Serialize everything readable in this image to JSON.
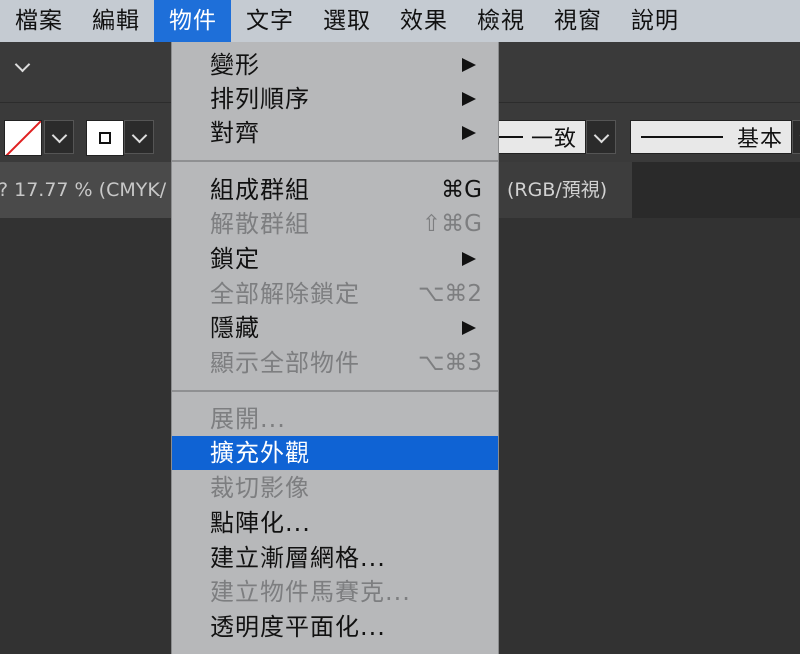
{
  "menubar": {
    "items": [
      "檔案",
      "編輯",
      "物件",
      "文字",
      "選取",
      "效果",
      "檢視",
      "視窗",
      "說明"
    ],
    "active": "物件"
  },
  "toolbar": {
    "stroke_profile": "一致",
    "brush": "基本"
  },
  "tabs": {
    "doc1": "17.77 % (CMYK/",
    "doc2": "(RGB/預視)"
  },
  "object_menu": {
    "items": [
      {
        "label": "變形",
        "shortcut": "",
        "submenu": true,
        "enabled": true
      },
      {
        "label": "排列順序",
        "shortcut": "",
        "submenu": true,
        "enabled": true
      },
      {
        "label": "對齊",
        "shortcut": "",
        "submenu": true,
        "enabled": true
      },
      {
        "label": "組成群組",
        "shortcut": "⌘G",
        "submenu": false,
        "enabled": true
      },
      {
        "label": "解散群組",
        "shortcut": "⇧⌘G",
        "submenu": false,
        "enabled": false
      },
      {
        "label": "鎖定",
        "shortcut": "",
        "submenu": true,
        "enabled": true
      },
      {
        "label": "全部解除鎖定",
        "shortcut": "⌥⌘2",
        "submenu": false,
        "enabled": false
      },
      {
        "label": "隱藏",
        "shortcut": "",
        "submenu": true,
        "enabled": true
      },
      {
        "label": "顯示全部物件",
        "shortcut": "⌥⌘3",
        "submenu": false,
        "enabled": false
      },
      {
        "label": "展開...",
        "shortcut": "",
        "submenu": false,
        "enabled": false
      },
      {
        "label": "擴充外觀",
        "shortcut": "",
        "submenu": false,
        "enabled": true,
        "highlighted": true
      },
      {
        "label": "裁切影像",
        "shortcut": "",
        "submenu": false,
        "enabled": false
      },
      {
        "label": "點陣化...",
        "shortcut": "",
        "submenu": false,
        "enabled": true
      },
      {
        "label": "建立漸層網格...",
        "shortcut": "",
        "submenu": false,
        "enabled": true
      },
      {
        "label": "建立物件馬賽克...",
        "shortcut": "",
        "submenu": false,
        "enabled": false
      },
      {
        "label": "透明度平面化...",
        "shortcut": "",
        "submenu": false,
        "enabled": true
      }
    ]
  },
  "colors": {
    "menubar_bg": "#c5cbd2",
    "menu_bg": "#b7b8ba",
    "highlight": "#0f63d4",
    "workspace": "#323232"
  }
}
